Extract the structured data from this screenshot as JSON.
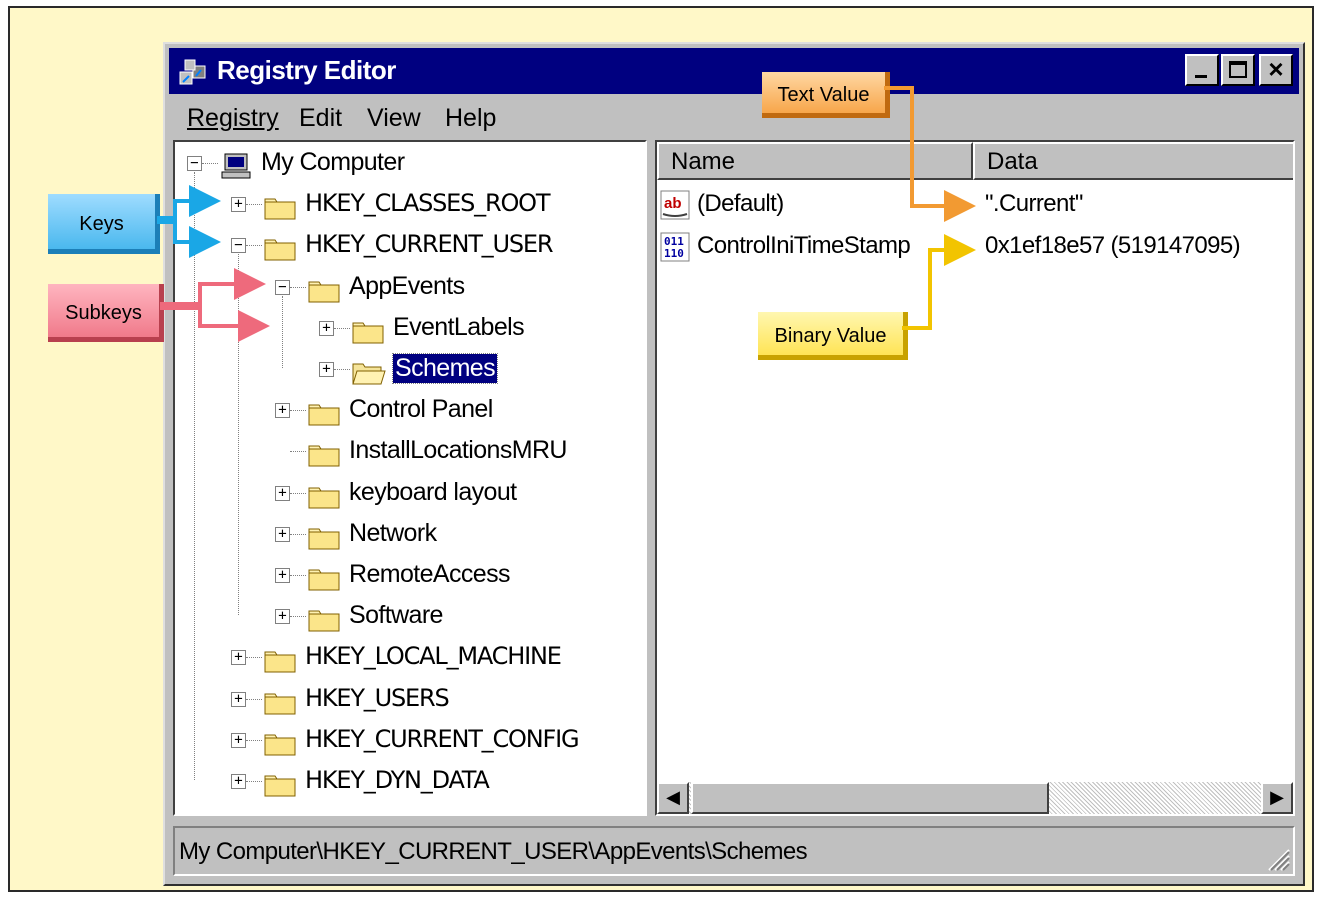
{
  "window": {
    "title": "Registry Editor",
    "buttons": {
      "minimize": "_",
      "maximize": "□",
      "close": "×"
    }
  },
  "menu": [
    {
      "label": "Registry"
    },
    {
      "label": "Edit"
    },
    {
      "label": "View"
    },
    {
      "label": "Help"
    }
  ],
  "tree": [
    {
      "label": "My Computer",
      "icon": "computer-icon",
      "expander": "minus"
    },
    {
      "label": "HKEY_CLASSES_ROOT",
      "icon": "folder-icon",
      "expander": "plus"
    },
    {
      "label": "HKEY_CURRENT_USER",
      "icon": "folder-icon",
      "expander": "minus"
    },
    {
      "label": "AppEvents",
      "icon": "folder-icon",
      "expander": "minus"
    },
    {
      "label": "EventLabels",
      "icon": "folder-icon",
      "expander": "plus"
    },
    {
      "label": "Schemes",
      "icon": "folder-open-icon",
      "expander": "plus",
      "selected": true
    },
    {
      "label": "Control Panel",
      "icon": "folder-icon",
      "expander": "plus"
    },
    {
      "label": "InstallLocationsMRU",
      "icon": "folder-icon",
      "expander": "none"
    },
    {
      "label": "keyboard layout",
      "icon": "folder-icon",
      "expander": "plus"
    },
    {
      "label": "Network",
      "icon": "folder-icon",
      "expander": "plus"
    },
    {
      "label": "RemoteAccess",
      "icon": "folder-icon",
      "expander": "plus"
    },
    {
      "label": "Software",
      "icon": "folder-icon",
      "expander": "plus"
    },
    {
      "label": "HKEY_LOCAL_MACHINE",
      "icon": "folder-icon",
      "expander": "plus"
    },
    {
      "label": "HKEY_USERS",
      "icon": "folder-icon",
      "expander": "plus"
    },
    {
      "label": "HKEY_CURRENT_CONFIG",
      "icon": "folder-icon",
      "expander": "plus"
    },
    {
      "label": "HKEY_DYN_DATA",
      "icon": "folder-icon",
      "expander": "plus"
    }
  ],
  "list": {
    "columns": {
      "name": "Name",
      "data": "Data"
    },
    "rows": [
      {
        "name": "(Default)",
        "data": "\".Current\"",
        "icon": "string-value-icon"
      },
      {
        "name": "ControlIniTimeStamp",
        "data": "0x1ef18e57 (519147095)",
        "icon": "binary-value-icon"
      }
    ]
  },
  "status": {
    "path": "My Computer\\HKEY_CURRENT_USER\\AppEvents\\Schemes"
  },
  "callouts": {
    "keys": "Keys",
    "subkeys": "Subkeys",
    "text_value": "Text Value",
    "binary_value": "Binary Value"
  },
  "colors": {
    "background": "#fff8c8",
    "titlebar": "#000080",
    "keys_arrow": "#1aa7e6",
    "subkeys_arrow": "#ee6a7c",
    "text_arrow": "#f29a32",
    "binary_arrow": "#f2c400"
  }
}
